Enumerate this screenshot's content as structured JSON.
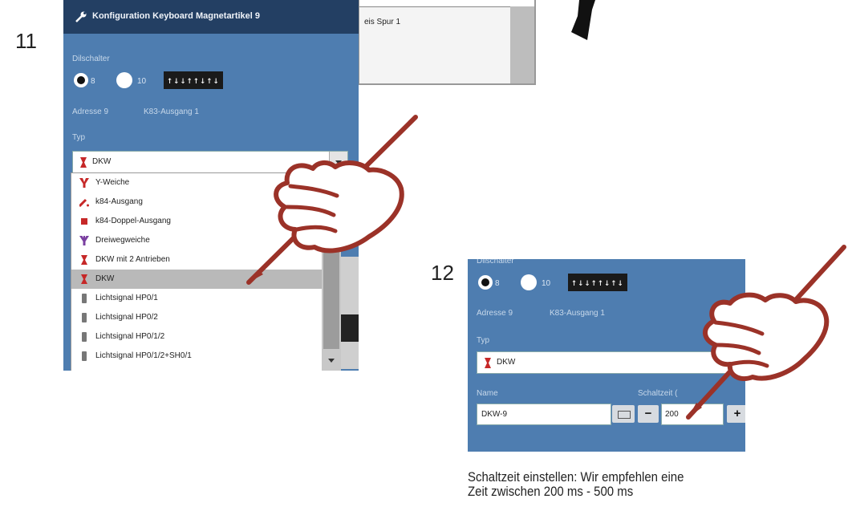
{
  "steps": {
    "step11": "11",
    "step12": "12"
  },
  "background_dialog": {
    "text": "eis Spur 1"
  },
  "panel11": {
    "title": "Konfiguration Keyboard Magnetartikel 9",
    "dip_label": "Dilschalter",
    "radio_8": "8",
    "radio_10": "10",
    "dip_display": "↑↓↓↑↑↓↑↓",
    "address": "Adresse 9",
    "output": "K83-Ausgang 1",
    "type_label": "Typ",
    "type_value": "DKW",
    "dropdown_items": [
      {
        "label": "Y-Weiche",
        "icon": "y-switch-icon"
      },
      {
        "label": "k84-Ausgang",
        "icon": "k84-output-icon"
      },
      {
        "label": "k84-Doppel-Ausgang",
        "icon": "k84-double-output-icon"
      },
      {
        "label": "Dreiwegweiche",
        "icon": "three-way-switch-icon"
      },
      {
        "label": "DKW mit 2 Antrieben",
        "icon": "dkw-icon"
      },
      {
        "label": "DKW",
        "icon": "dkw-icon"
      },
      {
        "label": "Lichtsignal HP0/1",
        "icon": "light-signal-icon"
      },
      {
        "label": "Lichtsignal HP0/2",
        "icon": "light-signal-icon"
      },
      {
        "label": "Lichtsignal HP0/1/2",
        "icon": "light-signal-icon"
      },
      {
        "label": "Lichtsignal HP0/1/2+SH0/1",
        "icon": "light-signal-icon"
      }
    ],
    "selected_item": "DKW"
  },
  "panel12": {
    "dip_label": "Dilschalter",
    "radio_8": "8",
    "radio_10": "10",
    "dip_display": "↑↓↓↑↑↓↑↓",
    "address": "Adresse 9",
    "output": "K83-Ausgang 1",
    "type_label": "Typ",
    "type_value": "DKW",
    "name_label": "Name",
    "name_value": "DKW-9",
    "time_label": "Schaltzeit (",
    "time_value": "200",
    "minus": "−",
    "plus": "+"
  },
  "caption": {
    "line1": "Schaltzeit einstellen: Wir empfehlen eine",
    "line2": "Zeit zwischen 200 ms - 500 ms"
  },
  "colors": {
    "panel_blue": "#4e7db0",
    "title_dark": "#233f63",
    "hand_red": "#9b3228",
    "dkw_red": "#c62828"
  }
}
